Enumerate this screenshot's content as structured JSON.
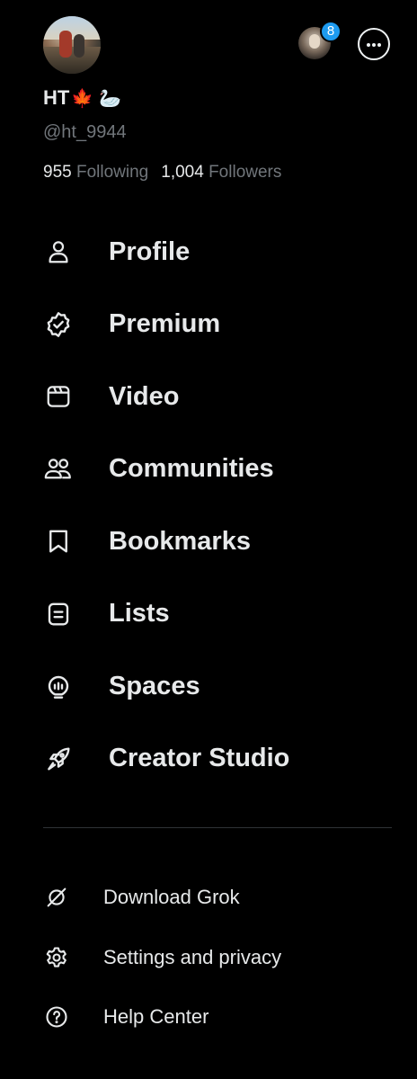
{
  "header": {
    "display_name": "HT",
    "name_emojis": [
      "🍁",
      "🦢"
    ],
    "handle": "@ht_9944",
    "following_count": "955",
    "following_label": "Following",
    "followers_count": "1,004",
    "followers_label": "Followers",
    "notification_count": "8",
    "avatar_icon": "profile-photo",
    "account_switch_icon": "account-photo",
    "more_icon": "ellipsis-circle-icon"
  },
  "menu": {
    "items": [
      {
        "label": "Profile",
        "icon": "person-icon"
      },
      {
        "label": "Premium",
        "icon": "verified-badge-icon"
      },
      {
        "label": "Video",
        "icon": "video-icon"
      },
      {
        "label": "Communities",
        "icon": "communities-icon"
      },
      {
        "label": "Bookmarks",
        "icon": "bookmark-icon"
      },
      {
        "label": "Lists",
        "icon": "list-icon"
      },
      {
        "label": "Spaces",
        "icon": "spaces-icon"
      },
      {
        "label": "Creator Studio",
        "icon": "rocket-icon"
      }
    ]
  },
  "secondary_menu": {
    "items": [
      {
        "label": "Download Grok",
        "icon": "grok-icon"
      },
      {
        "label": "Settings and privacy",
        "icon": "gear-icon"
      },
      {
        "label": "Help Center",
        "icon": "help-icon"
      }
    ]
  },
  "colors": {
    "background": "#000000",
    "text_primary": "#e7e9ea",
    "text_secondary": "#71767b",
    "badge": "#1d9bf0",
    "divider": "#2f3336"
  }
}
